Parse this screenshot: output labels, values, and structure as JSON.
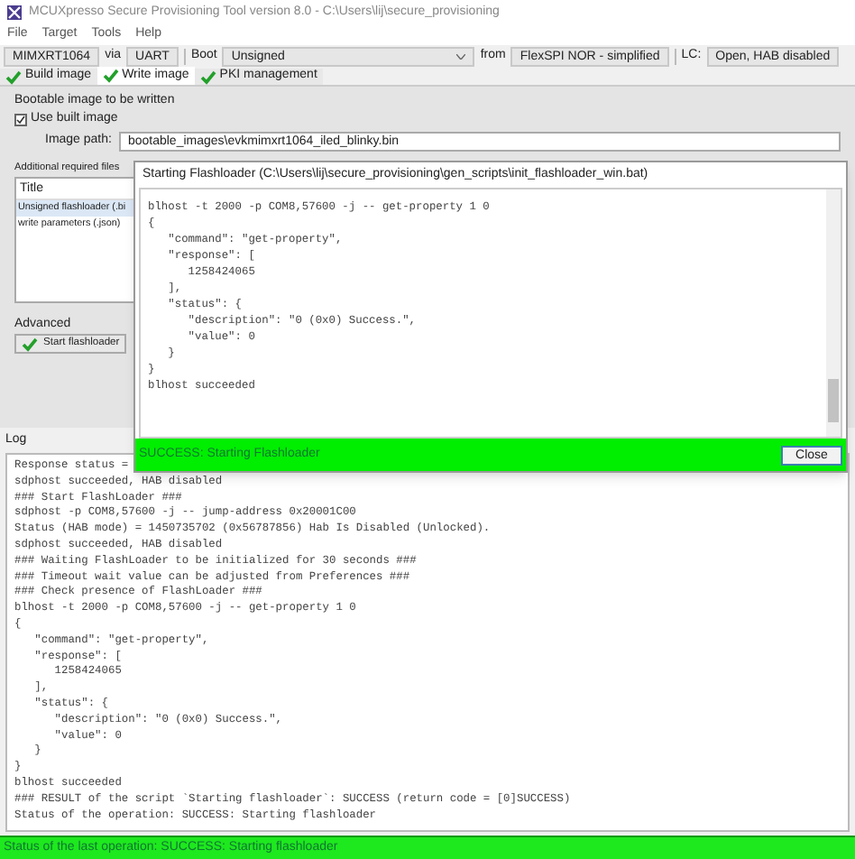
{
  "window": {
    "title": "MCUXpresso Secure Provisioning Tool version 8.0 - C:\\Users\\lij\\secure_provisioning"
  },
  "menu": [
    "File",
    "Target",
    "Tools",
    "Help"
  ],
  "toolbar": {
    "device": "MIMXRT1064",
    "via_label": "via",
    "connection": "UART",
    "boot_label": "Boot",
    "boot": "Unsigned",
    "from_label": "from",
    "memory": "FlexSPI NOR - simplified",
    "lc_label": "LC:",
    "lifecycle": "Open, HAB disabled"
  },
  "tabs": [
    {
      "label": "Build image",
      "selected": false
    },
    {
      "label": "Write image",
      "selected": true
    },
    {
      "label": "PKI management",
      "selected": false
    }
  ],
  "write_image": {
    "section_title": "Bootable image to be written",
    "use_built_image": {
      "label": "Use built image",
      "checked": true
    },
    "image_path_label": "Image path:",
    "image_path": "bootable_images\\evkmimxrt1064_iled_blinky.bin",
    "files_title": "Additional required files",
    "files_column": "Title",
    "files": [
      {
        "title": "Unsigned flashloader (.bi",
        "selected": true
      },
      {
        "title": "write parameters (.json)",
        "selected": false
      }
    ],
    "advanced_label": "Advanced",
    "start_button": "Start flashloader"
  },
  "log": {
    "title": "Log",
    "lines": [
      "Response status =",
      "sdphost succeeded, HAB disabled",
      "### Start FlashLoader ###",
      "sdphost -p COM8,57600 -j -- jump-address 0x20001C00",
      "Status (HAB mode) = 1450735702 (0x56787856) Hab Is Disabled (Unlocked).",
      "sdphost succeeded, HAB disabled",
      "### Waiting FlashLoader to be initialized for 30 seconds ###",
      "### Timeout wait value can be adjusted from Preferences ###",
      "### Check presence of FlashLoader ###",
      "blhost -t 2000 -p COM8,57600 -j -- get-property 1 0",
      "{",
      "   \"command\": \"get-property\",",
      "   \"response\": [",
      "      1258424065",
      "   ],",
      "   \"status\": {",
      "      \"description\": \"0 (0x0) Success.\",",
      "      \"value\": 0",
      "   }",
      "}",
      "blhost succeeded",
      "### RESULT of the script `Starting flashloader`: SUCCESS (return code = [0]SUCCESS)",
      "Status of the operation: SUCCESS: Starting flashloader"
    ]
  },
  "dialog": {
    "title": "Starting Flashloader (C:\\Users\\lij\\secure_provisioning\\gen_scripts\\init_flashloader_win.bat)",
    "lines": [
      "blhost -t 2000 -p COM8,57600 -j -- get-property 1 0",
      "{",
      "   \"command\": \"get-property\",",
      "   \"response\": [",
      "      1258424065",
      "   ],",
      "   \"status\": {",
      "      \"description\": \"0 (0x0) Success.\",",
      "      \"value\": 0",
      "   }",
      "}",
      "blhost succeeded"
    ],
    "status": "SUCCESS: Starting Flashloader",
    "close_button": "Close"
  },
  "status_bar": "Status of the last operation: SUCCESS: Starting flashloader"
}
